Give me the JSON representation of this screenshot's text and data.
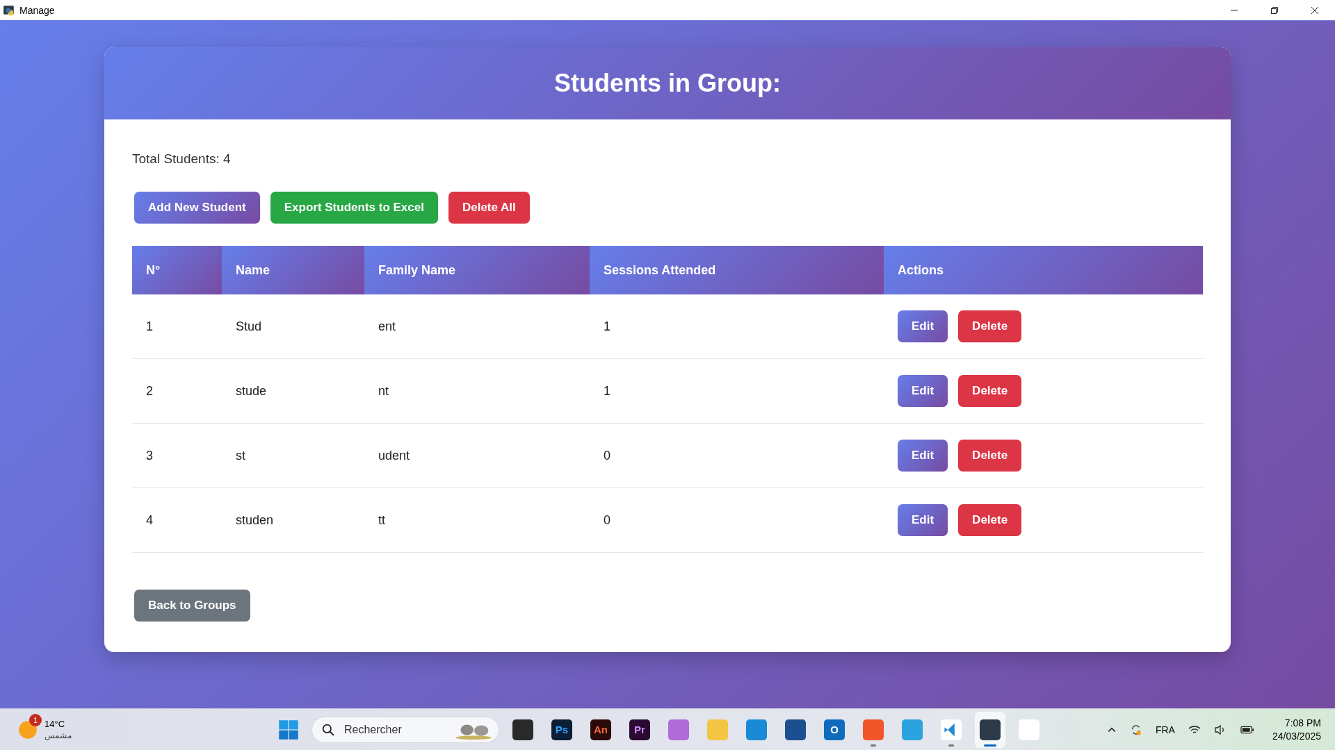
{
  "window": {
    "title": "Manage"
  },
  "page": {
    "title": "Students in Group:",
    "total": "Total Students: 4",
    "actions": [
      {
        "label": "Add New Student",
        "kind": "primary"
      },
      {
        "label": "Export Students to Excel",
        "kind": "success"
      },
      {
        "label": "Delete All",
        "kind": "danger"
      }
    ],
    "table": {
      "columns": [
        "N°",
        "Name",
        "Family Name",
        "Sessions Attended",
        "Actions"
      ],
      "rows": [
        {
          "n": "1",
          "name": "Stud",
          "family": "ent",
          "sessions": "1",
          "edit": "Edit",
          "delete": "Delete"
        },
        {
          "n": "2",
          "name": "stude",
          "family": "nt",
          "sessions": "1",
          "edit": "Edit",
          "delete": "Delete"
        },
        {
          "n": "3",
          "name": "st",
          "family": "udent",
          "sessions": "0",
          "edit": "Edit",
          "delete": "Delete"
        },
        {
          "n": "4",
          "name": "studen",
          "family": "tt",
          "sessions": "0",
          "edit": "Edit",
          "delete": "Delete"
        }
      ]
    },
    "back": "Back to Groups"
  },
  "taskbar": {
    "weather": {
      "temp": "14°C",
      "condition": "مشمس",
      "badge": "1"
    },
    "search": {
      "placeholder": "Rechercher"
    },
    "apps": [
      {
        "kind": "taskview",
        "running": false,
        "selected": false
      },
      {
        "kind": "ps",
        "label": "Ps",
        "running": false,
        "selected": false
      },
      {
        "kind": "an",
        "label": "An",
        "running": false,
        "selected": false
      },
      {
        "kind": "pr",
        "label": "Pr",
        "running": false,
        "selected": false
      },
      {
        "kind": "copilot",
        "running": false,
        "selected": false
      },
      {
        "kind": "folder",
        "running": false,
        "selected": false
      },
      {
        "kind": "edge",
        "running": false,
        "selected": false
      },
      {
        "kind": "store",
        "running": false,
        "selected": false
      },
      {
        "kind": "outlook",
        "label": "O",
        "running": false,
        "selected": false
      },
      {
        "kind": "brave",
        "running": true,
        "selected": false
      },
      {
        "kind": "telegram",
        "running": false,
        "selected": false
      },
      {
        "kind": "vscode",
        "running": true,
        "selected": false
      },
      {
        "kind": "python",
        "running": true,
        "selected": true
      },
      {
        "kind": "snip",
        "running": false,
        "selected": false
      }
    ],
    "language": "FRA",
    "time": "7:08 PM",
    "date": "24/03/2025"
  }
}
